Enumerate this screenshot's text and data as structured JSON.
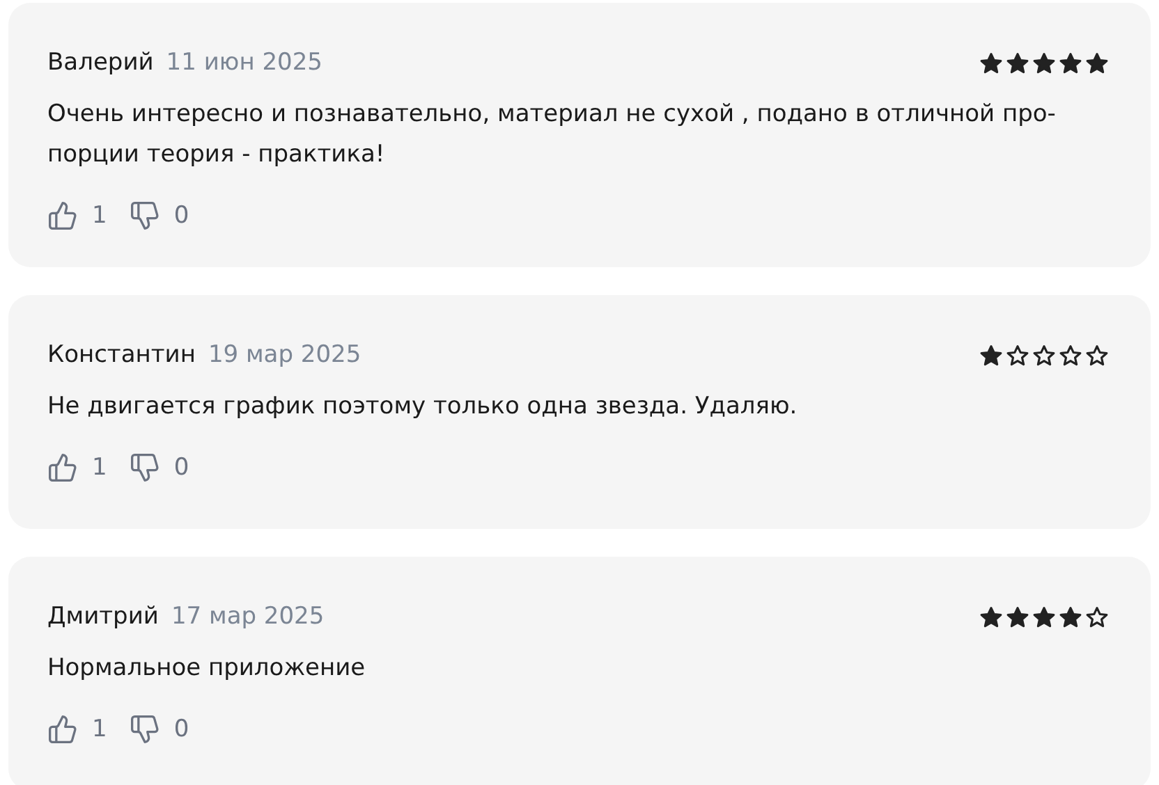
{
  "reviews": [
    {
      "author": "Валерий",
      "date": "11 июн 2025",
      "stars": 5,
      "text": "Очень интересно и познавательно, материал не сухой , подано в отличной про-\nпорции теория - практика!",
      "likes": "1",
      "dislikes": "0"
    },
    {
      "author": "Константин",
      "date": "19 мар 2025",
      "stars": 1,
      "text": "Не двигается график поэтому только одна звезда. Удаляю.",
      "likes": "1",
      "dislikes": "0"
    },
    {
      "author": "Дмитрий",
      "date": "17 мар 2025",
      "stars": 4,
      "text": "Нормальное приложение",
      "likes": "1",
      "dislikes": "0"
    }
  ]
}
